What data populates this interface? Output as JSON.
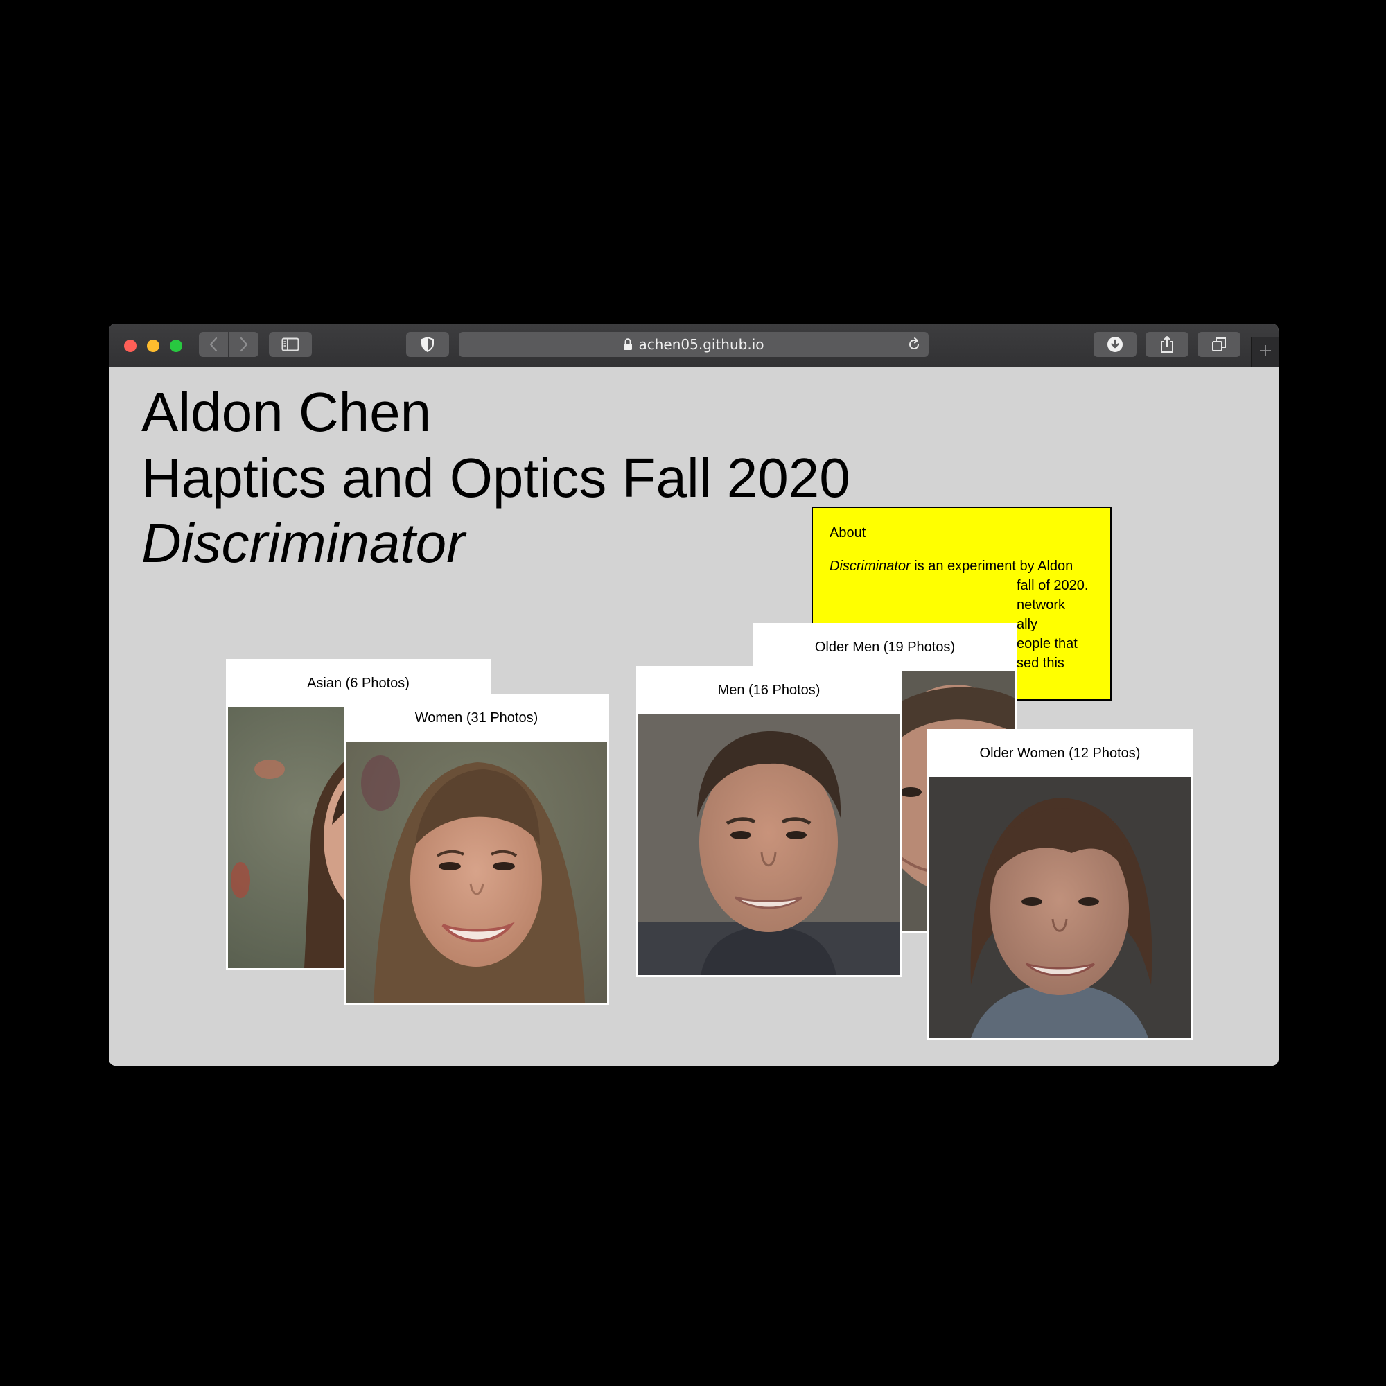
{
  "browser": {
    "url": "achen05.github.io"
  },
  "page": {
    "heading_name": "Aldon Chen",
    "heading_course": "Haptics and Optics Fall 2020",
    "heading_project": "Discriminator"
  },
  "about": {
    "title": "About",
    "project_name": "Discriminator",
    "lines": [
      " is an experiment by Aldon",
      "fall of 2020.",
      "network",
      "ally",
      "eople that",
      "sed this"
    ]
  },
  "cards": {
    "asian": "Asian (6 Photos)",
    "women": "Women (31 Photos)",
    "older_men": "Older Men (19 Photos)",
    "men": "Men (16 Photos)",
    "older_women": "Older Women (12 Photos)"
  },
  "colors": {
    "page_background": "#d3d3d3",
    "about_background": "#ffff00",
    "titlebar": "#3a3a3c",
    "card_border": "#ffffff"
  },
  "icons": [
    "close-dot",
    "minimize-dot",
    "zoom-dot",
    "chevron-left-icon",
    "chevron-right-icon",
    "sidebar-icon",
    "shield-icon",
    "lock-icon",
    "reload-icon",
    "download-icon",
    "share-icon",
    "tabs-icon",
    "plus-icon"
  ]
}
